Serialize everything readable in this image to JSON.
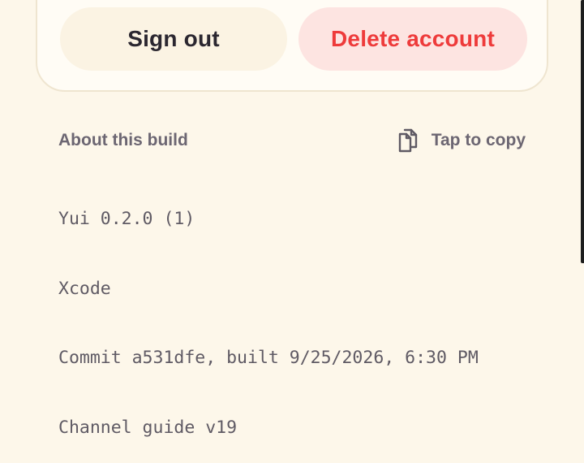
{
  "account_actions": {
    "sign_out_label": "Sign out",
    "delete_account_label": "Delete account"
  },
  "about_build": {
    "title": "About this build",
    "copy_label": "Tap to copy",
    "copy_icon": "copy-icon",
    "lines": [
      "Yui 0.2.0 (1)",
      "Xcode",
      "Commit a531dfe, built 9/25/2026, 6:30 PM",
      "Channel guide v19"
    ]
  },
  "colors": {
    "background": "#fdf7ea",
    "danger": "#ee3b3b",
    "danger_bg": "#fde4e1",
    "text_primary": "#2b2730",
    "text_secondary": "#6c6672"
  }
}
